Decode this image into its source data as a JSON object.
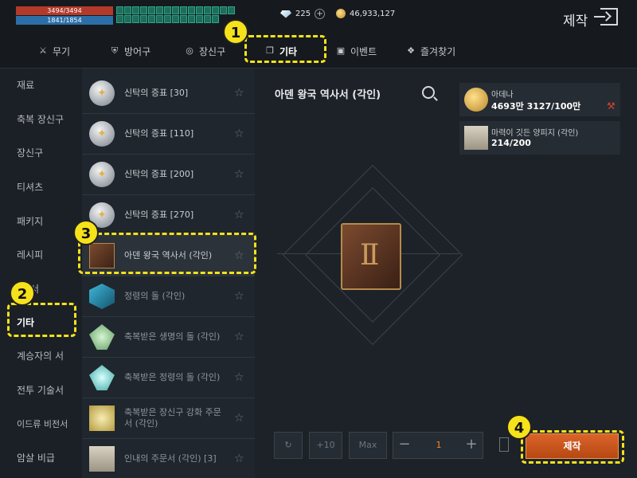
{
  "status": {
    "hp": "3494/3494",
    "mp": "1841/1854"
  },
  "currency": {
    "diamonds": "225",
    "adena": "46,933,127"
  },
  "header": {
    "title": "제작"
  },
  "tabs": [
    {
      "label": "무기",
      "icon": "sword-icon"
    },
    {
      "label": "방어구",
      "icon": "shield-icon"
    },
    {
      "label": "장신구",
      "icon": "ring-icon"
    },
    {
      "label": "기타",
      "icon": "cube-icon"
    },
    {
      "label": "이벤트",
      "icon": "event-icon"
    },
    {
      "label": "즐겨찾기",
      "icon": "bookmark-icon"
    }
  ],
  "sidebar": {
    "items": [
      {
        "label": "재료"
      },
      {
        "label": "축복 장신구"
      },
      {
        "label": "장신구"
      },
      {
        "label": "티셔츠"
      },
      {
        "label": "패키지"
      },
      {
        "label": "레시피"
      },
      {
        "label": "서"
      },
      {
        "label": "기타"
      },
      {
        "label": "계승자의 서"
      },
      {
        "label": "전투 기술서"
      },
      {
        "label": "이드류 비전서"
      },
      {
        "label": "암살 비급"
      }
    ]
  },
  "list": {
    "items": [
      {
        "name": "신탁의 증표 [30]"
      },
      {
        "name": "신탁의 증표 [110]"
      },
      {
        "name": "신탁의 증표 [200]"
      },
      {
        "name": "신탁의 증표 [270]"
      },
      {
        "name": "아덴 왕국 역사서 (각인)"
      },
      {
        "name": "정령의 돌 (각인)"
      },
      {
        "name": "축복받은 생명의 돌 (각인)"
      },
      {
        "name": "축복받은 정령의 돌 (각인)"
      },
      {
        "name": "축복받은 장신구 강화 주문서 (각인)"
      },
      {
        "name": "인내의 주문서 (각인) [3]"
      }
    ]
  },
  "detail": {
    "title": "아덴 왕국 역사서 (각인)"
  },
  "materials": [
    {
      "name": "아데나",
      "qty": "4693만 3127/100만"
    },
    {
      "name": "마력이 깃든 양피지 (각인)",
      "qty": "214/200"
    }
  ],
  "controls": {
    "max": "Max",
    "plus10": "+10",
    "quantity": "1",
    "craft": "제작"
  },
  "annotations": [
    "1",
    "2",
    "3",
    "4"
  ]
}
